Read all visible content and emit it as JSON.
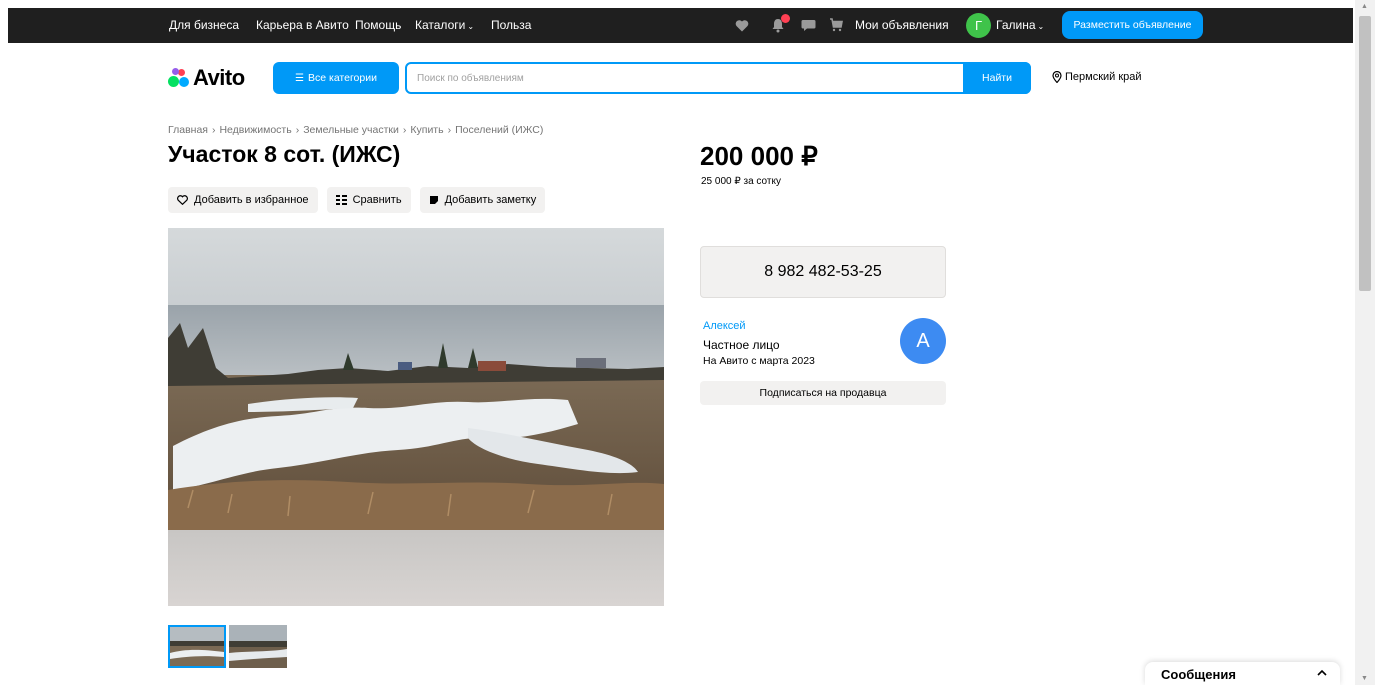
{
  "topbar": {
    "links": [
      "Для бизнеса",
      "Карьера в Авито",
      "Помощь",
      "Каталоги",
      "Польза"
    ],
    "my_ads": "Мои объявления",
    "user_initial": "Г",
    "user_name": "Галина",
    "post_ad": "Разместить объявление"
  },
  "header": {
    "logo": "Avito",
    "categories_button": "Все категории",
    "search_placeholder": "Поиск по объявлениям",
    "search_value": "",
    "find_button": "Найти",
    "region": "Пермский край"
  },
  "breadcrumb": [
    "Главная",
    "Недвижимость",
    "Земельные участки",
    "Купить",
    "Поселений (ИЖС)"
  ],
  "listing": {
    "title": "Участок 8 сот. (ИЖС)",
    "price": "200 000 ₽",
    "price_per_unit": "25 000 ₽ за сотку",
    "actions": {
      "favorite": "Добавить в избранное",
      "compare": "Сравнить",
      "note": "Добавить заметку"
    }
  },
  "seller": {
    "phone": "8 982 482-53-25",
    "name": "Алексей",
    "type": "Частное лицо",
    "since": "На Авито с марта 2023",
    "avatar_letter": "А",
    "subscribe": "Подписаться на продавца"
  },
  "messages": {
    "label": "Сообщения"
  },
  "colors": {
    "topbar_bg": "#1f1f1f",
    "accent": "#0099f7",
    "button_bg": "#f2f1f0",
    "avatar_seller": "#3d8bf2",
    "avatar_user": "#3fc34a"
  }
}
